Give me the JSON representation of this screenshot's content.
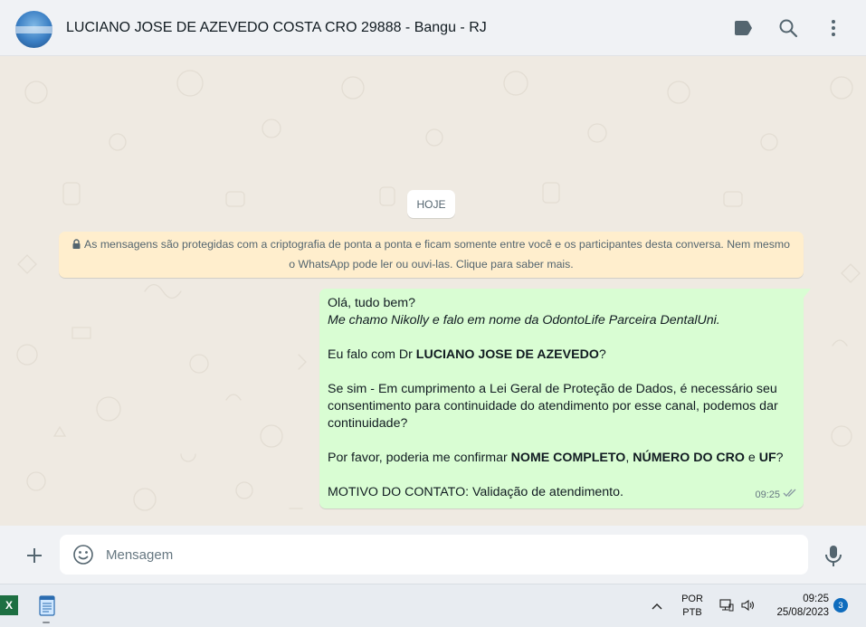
{
  "header": {
    "contact_name": "LUCIANO JOSE DE AZEVEDO COSTA CRO 29888 - Bangu - RJ",
    "icons": [
      "label-icon",
      "search-icon",
      "more-vertical-icon"
    ]
  },
  "chat": {
    "date_chip": "HOJE",
    "encryption_line1": "As mensagens são protegidas com a criptografia de ponta a ponta e ficam somente entre você e os participantes desta conversa. Nem mesmo",
    "encryption_line2": "o WhatsApp pode ler ou ouvi-las. Clique para saber mais.",
    "message": {
      "l1": "Olá, tudo bem?",
      "l2": "Me chamo Nikolly e falo em nome da OdontoLife Parceira DentalUni.",
      "l3_pre": "Eu falo com Dr ",
      "l3_bold": "LUCIANO JOSE DE AZEVEDO",
      "l3_post": "?",
      "l4": "Se sim - Em cumprimento a Lei Geral de Proteção de Dados, é necessário seu",
      "l5": "consentimento para continuidade do atendimento por esse canal, podemos dar",
      "l6": "continuidade?",
      "l7_pre": "Por favor, poderia me confirmar ",
      "l7_b1": "NOME COMPLETO",
      "l7_sep": ", ",
      "l7_b2": "NÚMERO DO CRO",
      "l7_and": " e ",
      "l7_b3": "UF",
      "l7_post": "?",
      "l8": "MOTIVO DO CONTATO: Validação de atendimento.",
      "time": "09:25",
      "status": "read"
    }
  },
  "composer": {
    "placeholder": "Mensagem"
  },
  "taskbar": {
    "lang_line1": "POR",
    "lang_line2": "PTB",
    "time": "09:25",
    "date": "25/08/2023",
    "notification_count": "3",
    "excel_letter": "X"
  },
  "colors": {
    "chat_bg": "#efeae2",
    "outgoing_bubble": "#d9fdd3",
    "encryption_bg": "#ffeecd",
    "header_bg": "#f0f2f5",
    "read_tick": "#8696a0"
  }
}
